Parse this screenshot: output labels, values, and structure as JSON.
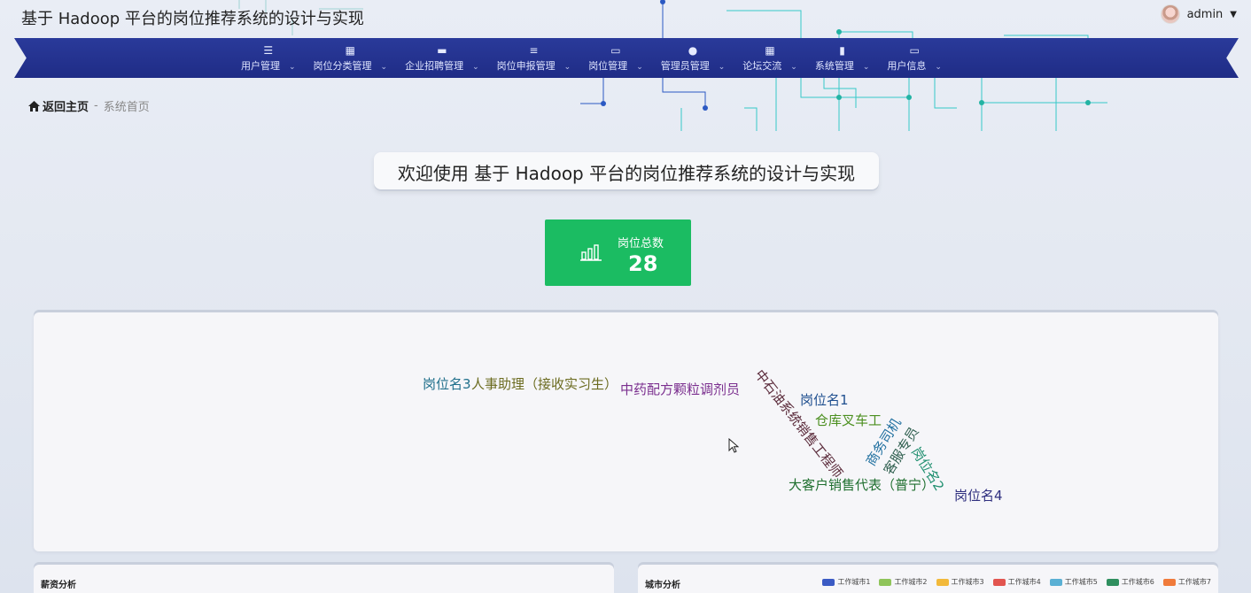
{
  "app": {
    "title": "基于 Hadoop 平台的岗位推荐系统的设计与实现"
  },
  "user": {
    "name": "admin"
  },
  "nav": [
    {
      "label": "用户管理",
      "icon": "list-icon",
      "glyph": "☰"
    },
    {
      "label": "岗位分类管理",
      "icon": "grid-icon",
      "glyph": "▦"
    },
    {
      "label": "企业招聘管理",
      "icon": "monitor-icon",
      "glyph": "▬"
    },
    {
      "label": "岗位申报管理",
      "icon": "sliders-icon",
      "glyph": "≡"
    },
    {
      "label": "岗位管理",
      "icon": "ticket-icon",
      "glyph": "▭"
    },
    {
      "label": "管理员管理",
      "icon": "user-icon",
      "glyph": "●"
    },
    {
      "label": "论坛交流",
      "icon": "grid-icon",
      "glyph": "▦"
    },
    {
      "label": "系统管理",
      "icon": "bar-chart-icon",
      "glyph": "▮"
    },
    {
      "label": "用户信息",
      "icon": "card-icon",
      "glyph": "▭"
    }
  ],
  "breadcrumb": {
    "home": "返回主页",
    "separator": "-",
    "current": "系统首页"
  },
  "welcome": "欢迎使用 基于 Hadoop 平台的岗位推荐系统的设计与实现",
  "stat": {
    "label": "岗位总数",
    "value": "28",
    "color": "#1bbc62"
  },
  "wordcloud": [
    {
      "text": "岗位名3",
      "color": "#1f6f8b"
    },
    {
      "text": "人事助理（接收实习生）",
      "color": "#6b6b1f"
    },
    {
      "text": "中药配方颗粒调剂员",
      "color": "#7b2f8f"
    },
    {
      "text": "中石油系统销售工程师",
      "color": "#5a2a3a"
    },
    {
      "text": "岗位名1",
      "color": "#1f4f8f"
    },
    {
      "text": "仓库叉车工",
      "color": "#4b8f1f"
    },
    {
      "text": "商务司机",
      "color": "#1f6f9f"
    },
    {
      "text": "客服专员",
      "color": "#2f5f4f"
    },
    {
      "text": "岗位名2",
      "color": "#1f8f6f"
    },
    {
      "text": "大客户销售代表（普宁）",
      "color": "#1f6f2f"
    },
    {
      "text": "岗位名4",
      "color": "#2f2f7f"
    }
  ],
  "panels": {
    "salary": {
      "title": "薪资分析"
    },
    "city": {
      "title": "城市分析",
      "legend": [
        {
          "label": "工作城市1",
          "color": "#3b5bc4"
        },
        {
          "label": "工作城市2",
          "color": "#8fc45a"
        },
        {
          "label": "工作城市3",
          "color": "#f2b93b"
        },
        {
          "label": "工作城市4",
          "color": "#e2554f"
        },
        {
          "label": "工作城市5",
          "color": "#5ab0d4"
        },
        {
          "label": "工作城市6",
          "color": "#2f8f5f"
        },
        {
          "label": "工作城市7",
          "color": "#f07b3b"
        }
      ]
    }
  }
}
